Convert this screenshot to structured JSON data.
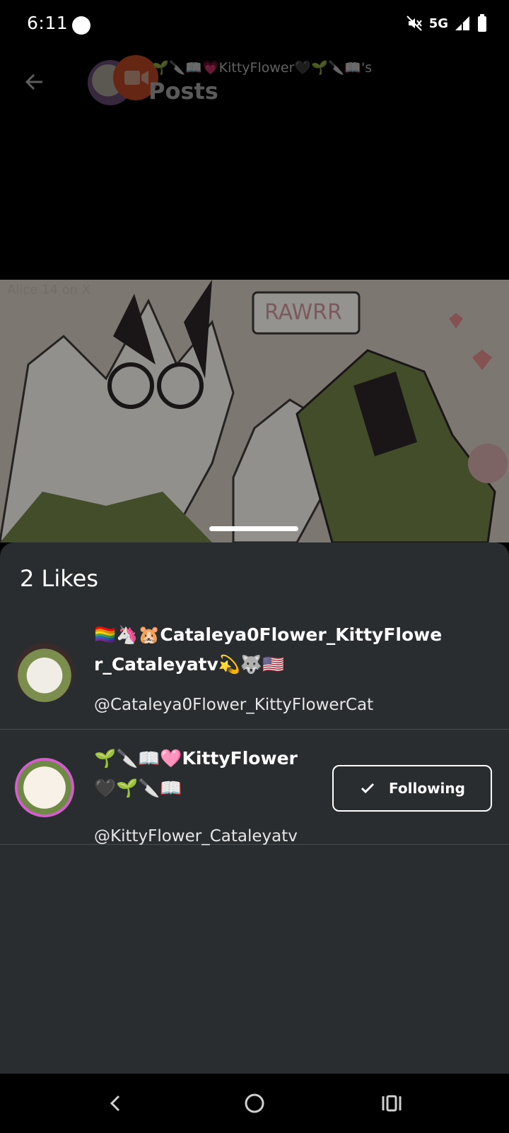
{
  "status": {
    "time": "6:11",
    "network": "5G"
  },
  "header": {
    "title_line": "🌱🔪📖💗KittyFlower🖤🌱🔪📖's",
    "subtitle": "Posts"
  },
  "artwork": {
    "corner_text": "Alice 14 on X",
    "speech_bubble": "RAWRR"
  },
  "likes": {
    "title": "2 Likes",
    "rows": [
      {
        "name_line1": "🏳️‍🌈🦄🐹Cataleya0Flower_KittyFlowe",
        "name_line2": "r_Cataleyatv💫🐺🇺🇸",
        "handle": "@Cataleya0Flower_KittyFlowerCat"
      },
      {
        "name_line1": "🌱🔪📖🩷KittyFlower",
        "name_line2": "🖤🌱🔪📖",
        "handle": "@KittyFlower_Cataleyatv",
        "follow_label": "Following"
      }
    ]
  },
  "colors": {
    "sheet_bg": "#2a2d2f",
    "divider": "#4a4d50",
    "accent_ring": "#d05fc9",
    "video_badge": "#e0552b"
  },
  "icons": [
    "silent-icon",
    "signal-icon",
    "battery-icon",
    "back-arrow-icon",
    "video-icon",
    "check-icon",
    "nav-back-icon",
    "nav-home-icon",
    "nav-recents-icon"
  ]
}
